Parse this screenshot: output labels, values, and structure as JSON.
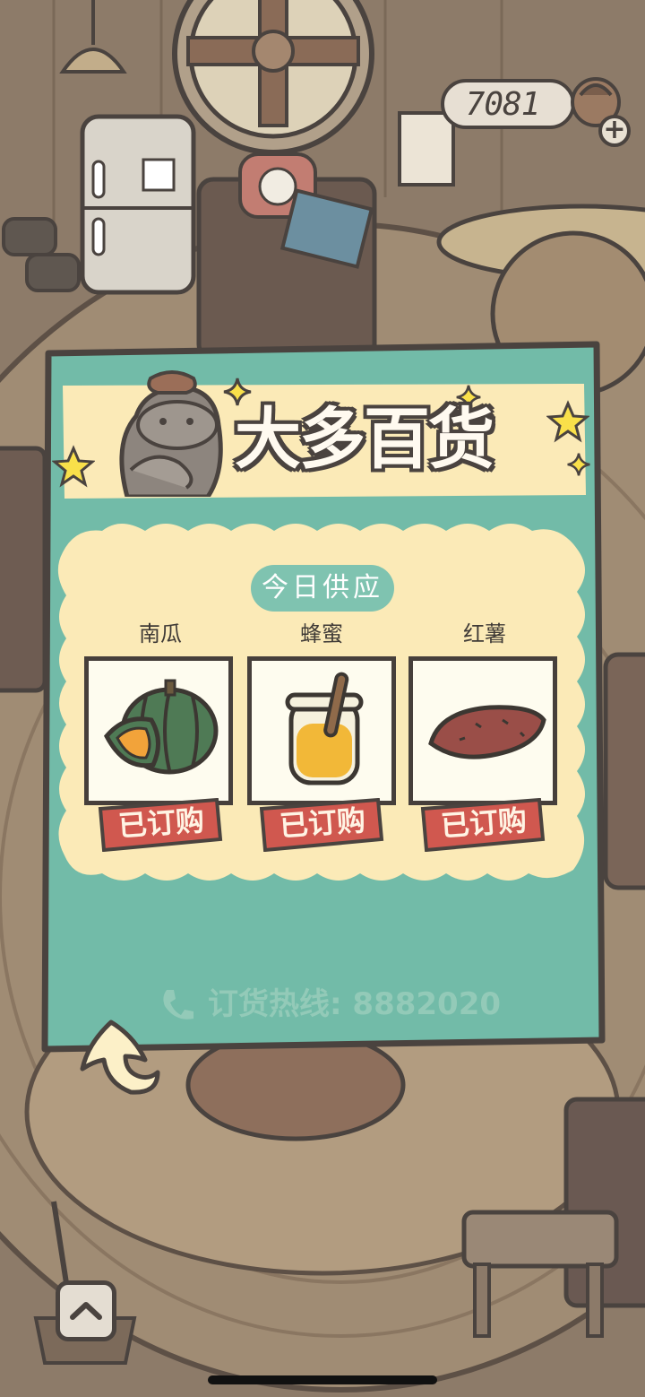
{
  "colors": {
    "panel_teal": "#72bba8",
    "card_cream": "#fbeab7",
    "stamp_red": "#d0584f",
    "outline": "#4a433f"
  },
  "hud": {
    "coins": "7081",
    "add_icon": "plus-icon"
  },
  "shop": {
    "title": "大多百货",
    "supply_label": "今日供应",
    "items": [
      {
        "name": "南瓜",
        "icon": "pumpkin-icon",
        "status": "已订购"
      },
      {
        "name": "蜂蜜",
        "icon": "honey-jar-icon",
        "status": "已订购"
      },
      {
        "name": "红薯",
        "icon": "sweet-potato-icon",
        "status": "已订购"
      }
    ],
    "hotline": "订货热线: 8882020"
  },
  "nav": {
    "back_icon": "back-arrow-icon",
    "up_icon": "chevron-up-icon"
  }
}
